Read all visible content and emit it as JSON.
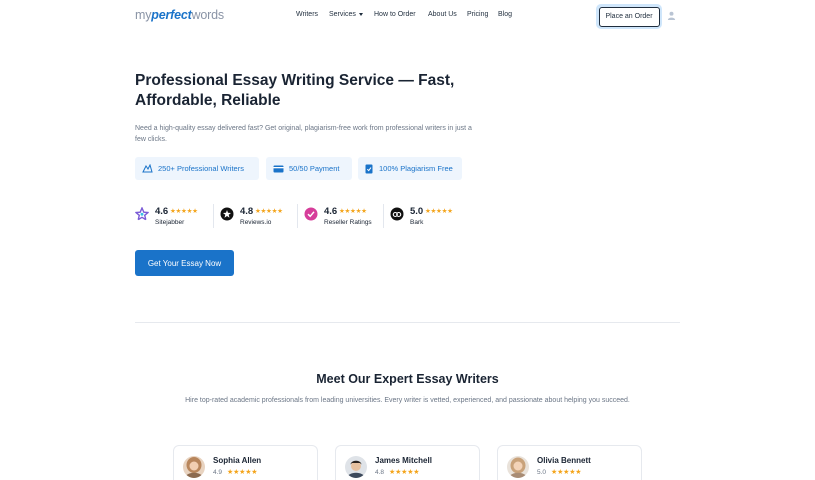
{
  "header": {
    "logo": {
      "part1": "my",
      "part2": "perfect",
      "part3": "words"
    },
    "nav": [
      {
        "label": "Writers"
      },
      {
        "label": "Services"
      },
      {
        "label": "How to Order"
      },
      {
        "label": "About Us"
      },
      {
        "label": "Pricing"
      },
      {
        "label": "Blog"
      }
    ],
    "place_order_label": "Place an Order",
    "user_icon": "user-icon"
  },
  "hero": {
    "title": "Professional Essay Writing Service — Fast, Affordable, Reliable",
    "subtitle": "Need a high-quality essay delivered fast? Get original, plagiarism-free work from professional writers in just a few clicks.",
    "features": [
      {
        "icon": "writer-pen-icon",
        "label": "250+ Professional Writers"
      },
      {
        "icon": "credit-card-icon",
        "label": "50/50 Payment"
      },
      {
        "icon": "document-check-icon",
        "label": "100% Plagiarism Free"
      }
    ],
    "ratings": [
      {
        "score": "4.6",
        "stars": "★★★★★",
        "name": "Sitejabber",
        "icon": "sitejabber-icon"
      },
      {
        "score": "4.8",
        "stars": "★★★★★",
        "name": "Reviews.io",
        "icon": "reviewsio-icon"
      },
      {
        "score": "4.6",
        "stars": "★★★★★",
        "name": "Reseller Ratings",
        "icon": "resellerratings-icon"
      },
      {
        "score": "5.0",
        "stars": "★★★★★",
        "name": "Bark",
        "icon": "bark-icon"
      }
    ],
    "cta_label": "Get Your Essay Now"
  },
  "writers_section": {
    "title": "Meet Our Expert Essay Writers",
    "subtitle": "Hire top-rated academic professionals from leading universities. Every writer is vetted, experienced, and passionate about helping you succeed.",
    "writers": [
      {
        "name": "Sophia Allen",
        "score": "4.9",
        "stars": "★★★★★"
      },
      {
        "name": "James Mitchell",
        "score": "4.8",
        "stars": "★★★★★"
      },
      {
        "name": "Olivia Bennett",
        "score": "5.0",
        "stars": "★★★★★"
      }
    ]
  },
  "colors": {
    "accent": "#1a73c9",
    "star": "#f4a51c",
    "text_dark": "#1a2433",
    "text_muted": "#6b7686",
    "feature_bg": "#eef5fd"
  }
}
